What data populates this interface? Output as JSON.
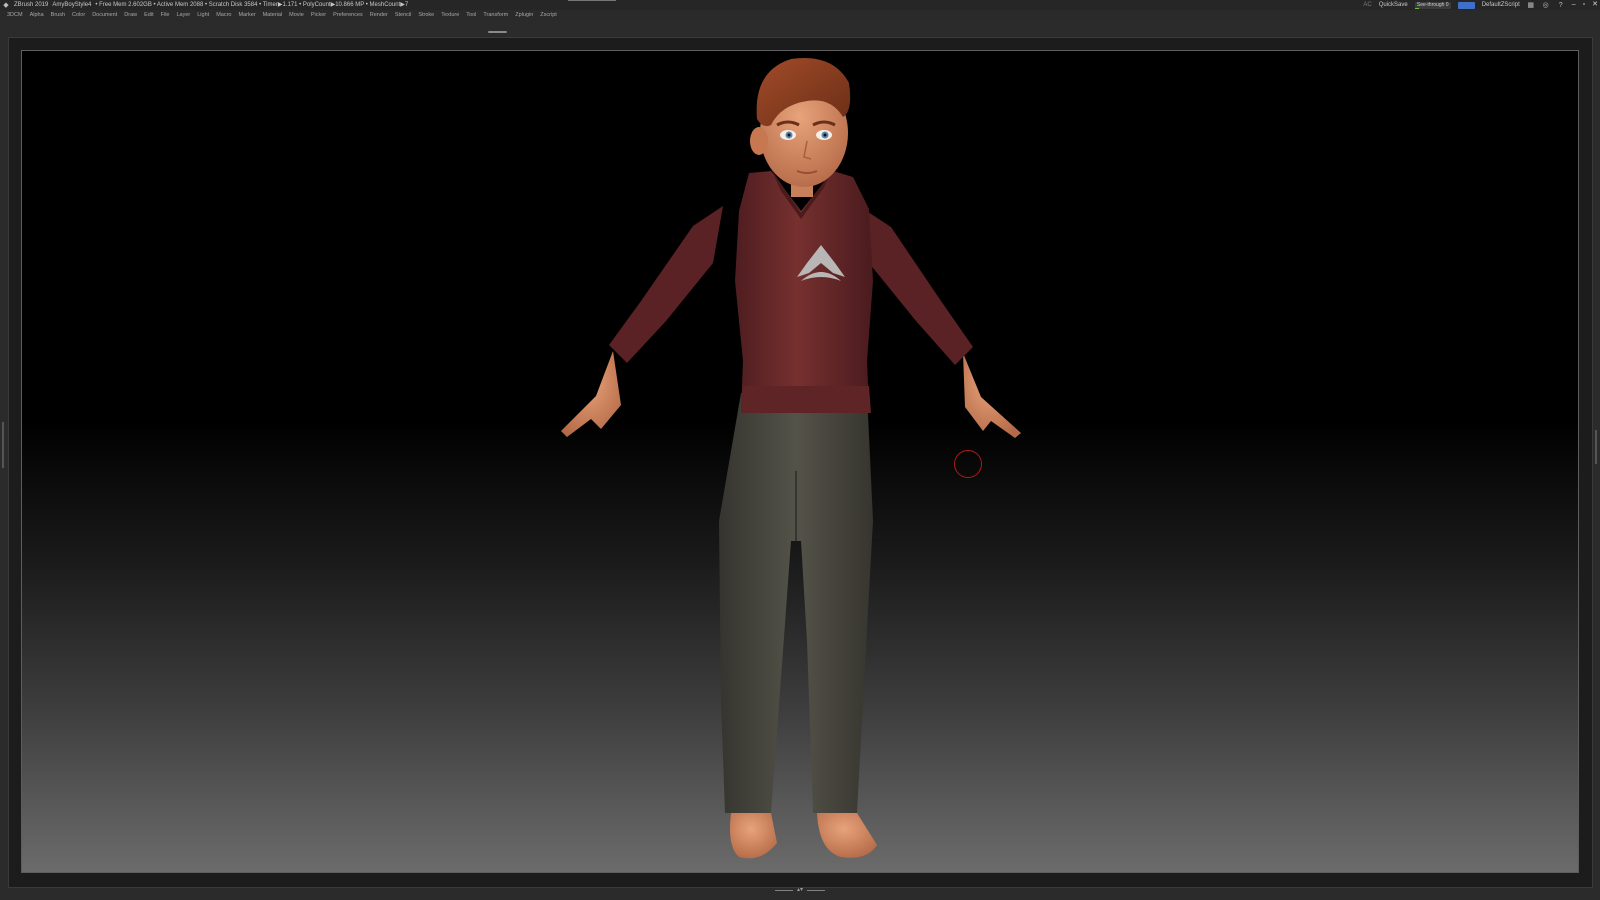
{
  "titlebar": {
    "app": "ZBrush 2019",
    "document": "AmyBoyStyle4",
    "stats": "• Free Mem 2.602GB • Active Mem 2088 • Scratch Disk 3584 • Timer▶1.171 • PolyCount▶10.866 MP • MeshCount▶7",
    "ac": "AC",
    "quicksave": "QuickSave",
    "seethrough_label": "See-through",
    "seethrough_value": "0",
    "script": "DefaultZScript"
  },
  "menu": [
    "3DCM",
    "Alpha",
    "Brush",
    "Color",
    "Document",
    "Draw",
    "Edit",
    "File",
    "Layer",
    "Light",
    "Macro",
    "Marker",
    "Material",
    "Movie",
    "Picker",
    "Preferences",
    "Render",
    "Stencil",
    "Stroke",
    "Texture",
    "Tool",
    "Transform",
    "Zplugin",
    "Zscript"
  ],
  "colors": {
    "hoodie": "#6b2a2c",
    "pants": "#4b4a42",
    "skin": "#d8926b",
    "hair": "#8a3e22",
    "accent_blue": "#3f6fc9",
    "brush_cursor": "#b01818"
  },
  "icons": [
    "menu-chip-icon",
    "layout-icon",
    "camera-icon",
    "help-icon",
    "minimize-icon",
    "restore-icon",
    "close-icon"
  ]
}
